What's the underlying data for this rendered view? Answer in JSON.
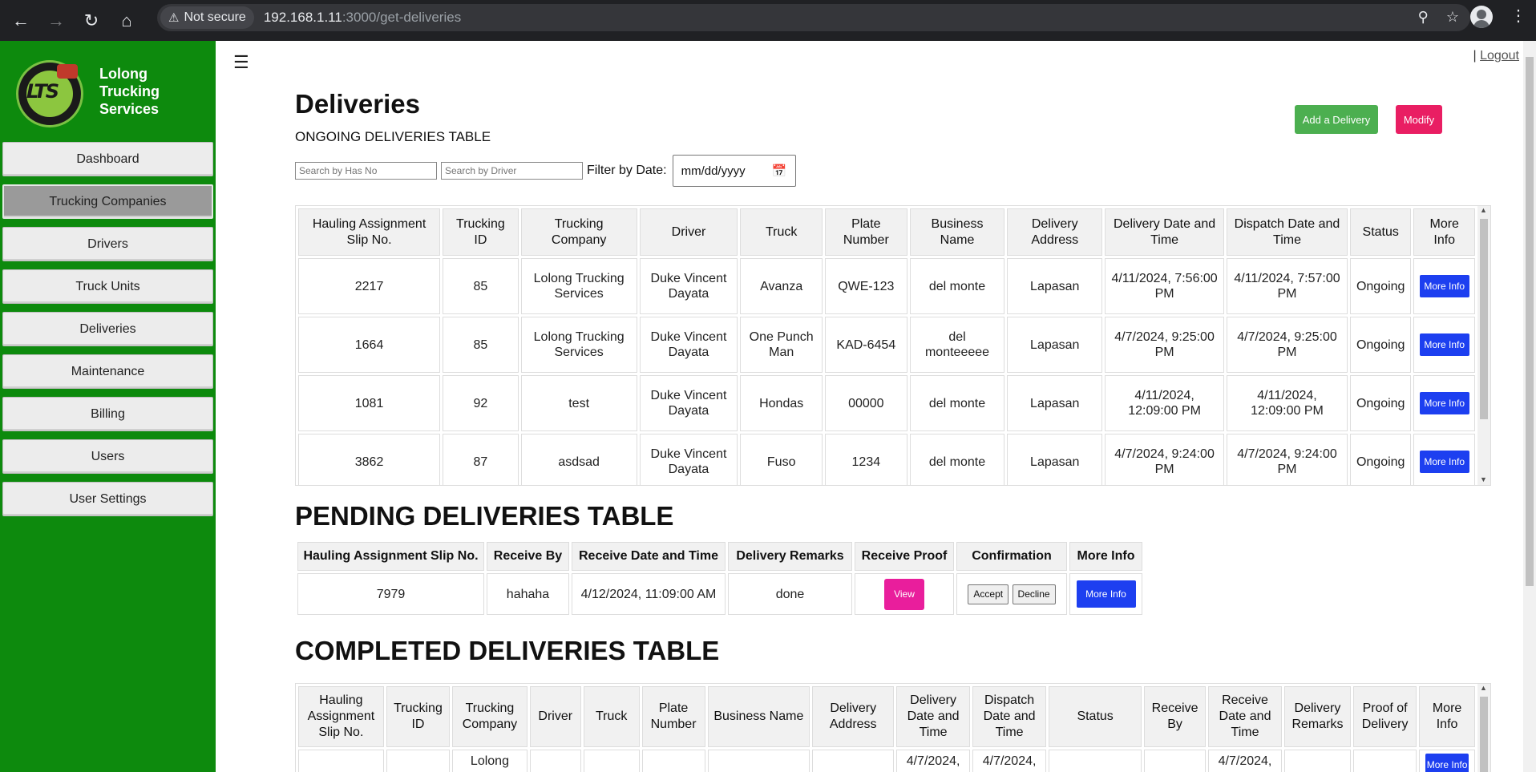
{
  "browser": {
    "security_label": "Not secure",
    "url_host": "192.168.1.11",
    "url_path": ":3000/get-deliveries"
  },
  "brand": {
    "name": "Lolong Trucking Services",
    "logo_letters": "LTS"
  },
  "sidebar": {
    "items": [
      {
        "label": "Dashboard"
      },
      {
        "label": "Trucking Companies"
      },
      {
        "label": "Drivers"
      },
      {
        "label": "Truck Units"
      },
      {
        "label": "Deliveries"
      },
      {
        "label": "Maintenance"
      },
      {
        "label": "Billing"
      },
      {
        "label": "Users"
      },
      {
        "label": "User Settings"
      }
    ]
  },
  "header": {
    "logout_sep": "|",
    "logout_label": "Logout"
  },
  "page": {
    "title": "Deliveries",
    "add_label": "Add a Delivery",
    "modify_label": "Modify",
    "ongoing_title": "ONGOING DELIVERIES TABLE",
    "search_has_placeholder": "Search by Has No",
    "search_driver_placeholder": "Search by Driver",
    "filter_label": "Filter by Date:",
    "date_placeholder": "mm/dd/yyyy",
    "pending_title": "PENDING DELIVERIES TABLE",
    "completed_title": "COMPLETED DELIVERIES TABLE"
  },
  "ongoing": {
    "headers": [
      "Hauling Assignment Slip No.",
      "Trucking ID",
      "Trucking Company",
      "Driver",
      "Truck",
      "Plate Number",
      "Business Name",
      "Delivery Address",
      "Delivery Date and Time",
      "Dispatch Date and Time",
      "Status",
      "More Info"
    ],
    "rows": [
      {
        "slip": "2217",
        "tid": "85",
        "company": "Lolong Trucking Services",
        "driver": "Duke Vincent Dayata",
        "truck": "Avanza",
        "plate": "QWE-123",
        "business": "del monte",
        "address": "Lapasan",
        "delivery": "4/11/2024, 7:56:00 PM",
        "dispatch": "4/11/2024, 7:57:00 PM",
        "status": "Ongoing",
        "more": "More Info"
      },
      {
        "slip": "1664",
        "tid": "85",
        "company": "Lolong Trucking Services",
        "driver": "Duke Vincent Dayata",
        "truck": "One Punch Man",
        "plate": "KAD-6454",
        "business": "del monteeeee",
        "address": "Lapasan",
        "delivery": "4/7/2024, 9:25:00 PM",
        "dispatch": "4/7/2024, 9:25:00 PM",
        "status": "Ongoing",
        "more": "More Info"
      },
      {
        "slip": "1081",
        "tid": "92",
        "company": "test",
        "driver": "Duke Vincent Dayata",
        "truck": "Hondas",
        "plate": "00000",
        "business": "del monte",
        "address": "Lapasan",
        "delivery": "4/11/2024, 12:09:00 PM",
        "dispatch": "4/11/2024, 12:09:00 PM",
        "status": "Ongoing",
        "more": "More Info"
      },
      {
        "slip": "3862",
        "tid": "87",
        "company": "asdsad",
        "driver": "Duke Vincent Dayata",
        "truck": "Fuso",
        "plate": "1234",
        "business": "del monte",
        "address": "Lapasan",
        "delivery": "4/7/2024, 9:24:00 PM",
        "dispatch": "4/7/2024, 9:24:00 PM",
        "status": "Ongoing",
        "more": "More Info"
      }
    ]
  },
  "pending": {
    "headers": [
      "Hauling Assignment Slip No.",
      "Receive By",
      "Receive Date and Time",
      "Delivery Remarks",
      "Receive Proof",
      "Confirmation",
      "More Info"
    ],
    "rows": [
      {
        "slip": "7979",
        "receive_by": "hahaha",
        "receive_dt": "4/12/2024, 11:09:00 AM",
        "remarks": "done",
        "view": "View",
        "accept": "Accept",
        "decline": "Decline",
        "more": "More Info"
      }
    ]
  },
  "completed": {
    "headers": [
      "Hauling Assignment Slip No.",
      "Trucking ID",
      "Trucking Company",
      "Driver",
      "Truck",
      "Plate Number",
      "Business Name",
      "Delivery Address",
      "Delivery Date and Time",
      "Dispatch Date and Time",
      "Status",
      "Receive By",
      "Receive Date and Time",
      "Delivery Remarks",
      "Proof of Delivery",
      "More Info"
    ],
    "partial_row": {
      "company": "Lolong",
      "delivery": "4/7/2024,",
      "dispatch": "4/7/2024,",
      "receive_dt": "4/7/2024,",
      "more": "More Info"
    }
  }
}
